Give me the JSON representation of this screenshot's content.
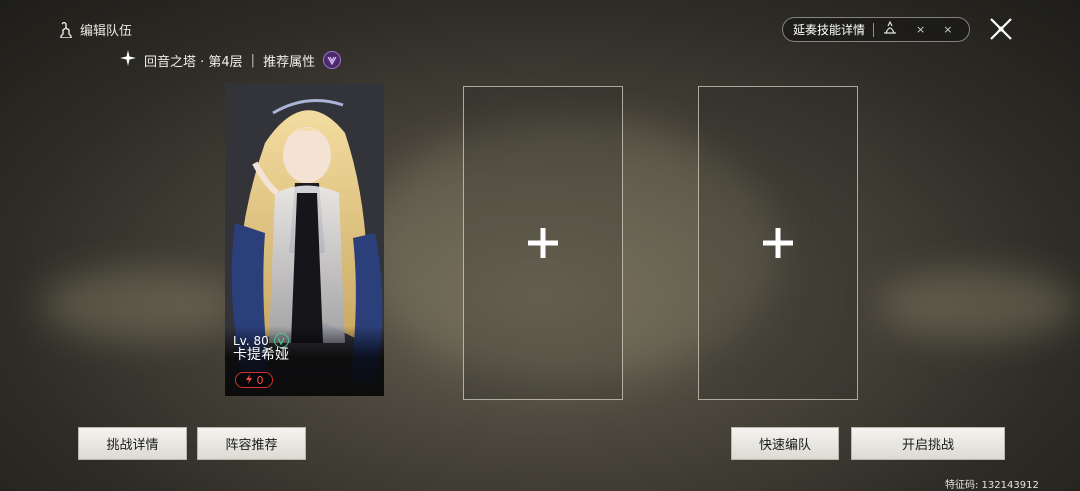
{
  "header": {
    "title": "编辑队伍",
    "stage": "回音之塔 · 第4层",
    "divider": "|",
    "recommend_attr_label": "推荐属性",
    "skill_detail_label": "延奏技能详情",
    "skill_slots": [
      "×",
      "×"
    ]
  },
  "team": {
    "character": {
      "level": "Lv. 80",
      "name": "卡提希娅",
      "energy": "0"
    },
    "empty_slot_symbol": "+"
  },
  "actions": {
    "challenge_details": "挑战详情",
    "lineup_recommend": "阵容推荐",
    "quick_team": "快速编队",
    "start_challenge": "开启挑战"
  },
  "footer": {
    "feature_code": "特征码: 132143912"
  },
  "colors": {
    "accent_attr": "#9a6fd0",
    "energy_red": "#d0312d",
    "level_green": "#56c48a"
  }
}
